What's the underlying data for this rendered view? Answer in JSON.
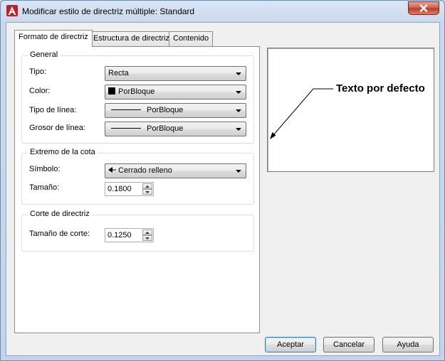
{
  "window": {
    "title": "Modificar estilo de directriz múltiple: Standard",
    "close_icon": "close-icon"
  },
  "tabs": [
    {
      "label": "Formato de directriz",
      "active": true
    },
    {
      "label": "Estructura de directriz",
      "active": false
    },
    {
      "label": "Contenido",
      "active": false
    }
  ],
  "general": {
    "title": "General",
    "tipo_label": "Tipo:",
    "tipo_value": "Recta",
    "color_label": "Color:",
    "color_value": "PorBloque",
    "linetype_label": "Tipo de línea:",
    "linetype_value": "PorBloque",
    "lineweight_label": "Grosor de línea:",
    "lineweight_value": "PorBloque"
  },
  "arrowhead": {
    "title": "Extremo de la cota",
    "symbol_label": "Símbolo:",
    "symbol_value": "Cerrado relleno",
    "size_label": "Tamaño:",
    "size_value": "0.1800"
  },
  "landing": {
    "title": "Corte de directriz",
    "break_size_label": "Tamaño de corte:",
    "break_size_value": "0.1250"
  },
  "preview": {
    "text": "Texto por defecto"
  },
  "buttons": {
    "ok": "Aceptar",
    "cancel": "Cancelar",
    "help": "Ayuda"
  },
  "colors": {
    "title_bar": "#c9d9ed",
    "close_button": "#c75a44",
    "app_icon": "#c0202a"
  }
}
